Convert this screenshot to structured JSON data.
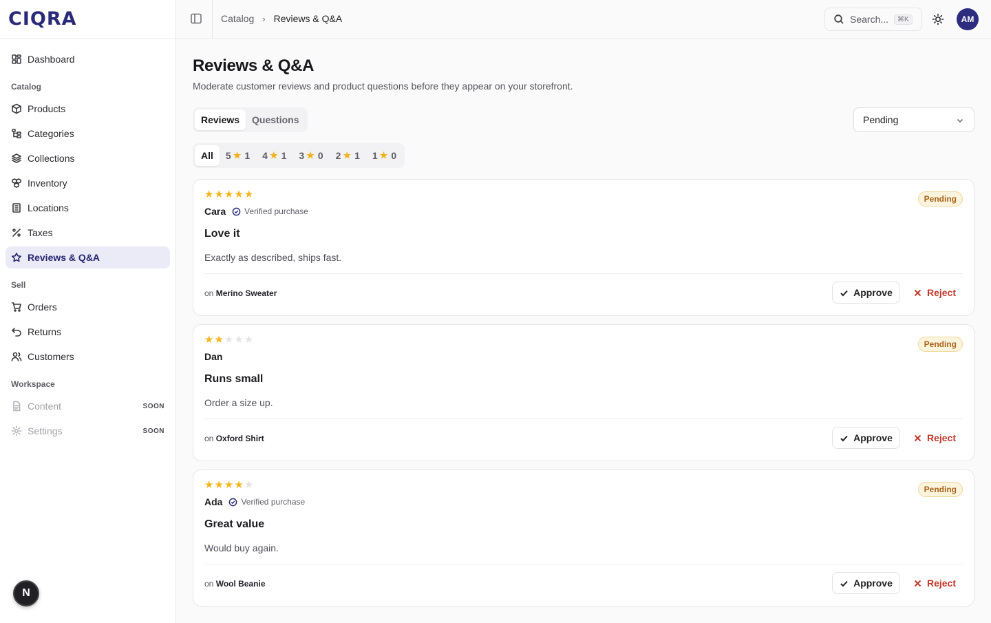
{
  "brand": {
    "name": "CIQRA"
  },
  "sidebar": {
    "top": [
      {
        "label": "Dashboard",
        "icon": "dashboard-icon"
      }
    ],
    "groups": [
      {
        "title": "Catalog",
        "items": [
          {
            "label": "Products",
            "icon": "box-icon"
          },
          {
            "label": "Categories",
            "icon": "tree-icon"
          },
          {
            "label": "Collections",
            "icon": "layers-icon"
          },
          {
            "label": "Inventory",
            "icon": "boxes-icon"
          },
          {
            "label": "Locations",
            "icon": "building-icon"
          },
          {
            "label": "Taxes",
            "icon": "percent-icon"
          },
          {
            "label": "Reviews & Q&A",
            "icon": "star-icon",
            "active": true
          }
        ]
      },
      {
        "title": "Sell",
        "items": [
          {
            "label": "Orders",
            "icon": "cart-icon"
          },
          {
            "label": "Returns",
            "icon": "undo-icon"
          },
          {
            "label": "Customers",
            "icon": "users-icon"
          }
        ]
      },
      {
        "title": "Workspace",
        "items": [
          {
            "label": "Content",
            "icon": "document-icon",
            "badge": "SOON"
          },
          {
            "label": "Settings",
            "icon": "gear-icon",
            "badge": "SOON"
          }
        ]
      }
    ],
    "floating_button": "N"
  },
  "topbar": {
    "breadcrumb": [
      "Catalog",
      "Reviews & Q&A"
    ],
    "search_placeholder": "Search...",
    "search_shortcut": "⌘K",
    "avatar_initials": "AM"
  },
  "page": {
    "title": "Reviews & Q&A",
    "subtitle": "Moderate customer reviews and product questions before they appear on your storefront.",
    "tabs": [
      "Reviews",
      "Questions"
    ],
    "status_filter": "Pending",
    "rating_filters": [
      {
        "label": "All"
      },
      {
        "stars": "5",
        "count": "1"
      },
      {
        "stars": "4",
        "count": "1"
      },
      {
        "stars": "3",
        "count": "0"
      },
      {
        "stars": "2",
        "count": "1"
      },
      {
        "stars": "1",
        "count": "0"
      }
    ]
  },
  "reviews": [
    {
      "rating": 5,
      "author": "Cara",
      "verified": "Verified purchase",
      "status": "Pending",
      "title": "Love it",
      "body": "Exactly as described, ships fast.",
      "on": "on",
      "product": "Merino Sweater",
      "approve": "Approve",
      "reject": "Reject"
    },
    {
      "rating": 2,
      "author": "Dan",
      "verified": "",
      "status": "Pending",
      "title": "Runs small",
      "body": "Order a size up.",
      "on": "on",
      "product": "Oxford Shirt",
      "approve": "Approve",
      "reject": "Reject"
    },
    {
      "rating": 4,
      "author": "Ada",
      "verified": "Verified purchase",
      "status": "Pending",
      "title": "Great value",
      "body": "Would buy again.",
      "on": "on",
      "product": "Wool Beanie",
      "approve": "Approve",
      "reject": "Reject"
    }
  ],
  "colors": {
    "brand": "#2b2a78",
    "star": "#f5b41d",
    "pending_badge": "#a9631a",
    "reject": "#c0392b"
  }
}
